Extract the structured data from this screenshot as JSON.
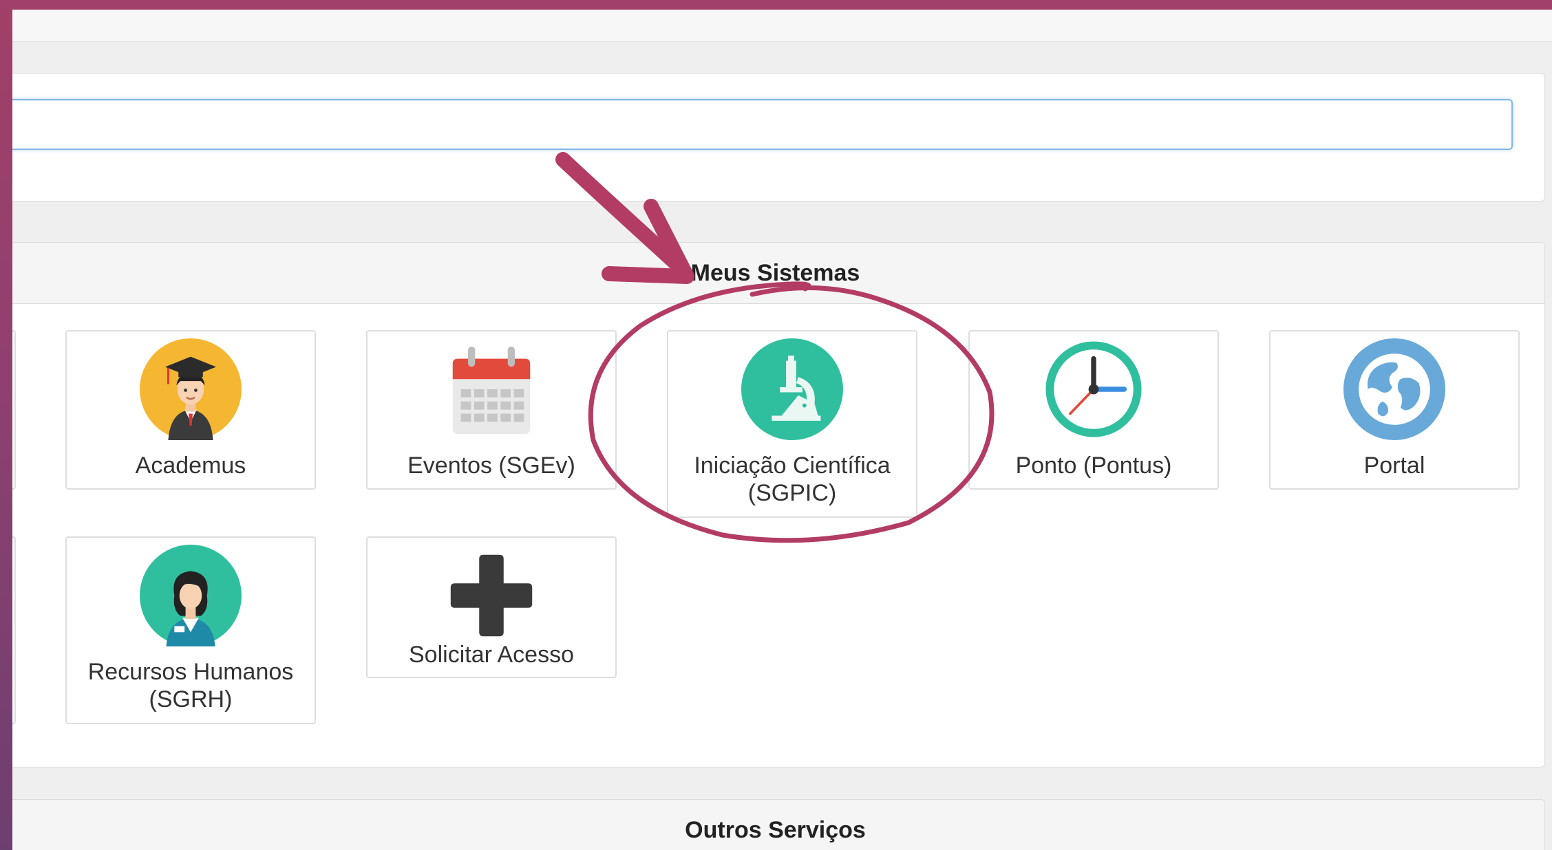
{
  "search": {
    "value": ""
  },
  "sections": {
    "my_systems_title": "Meus Sistemas",
    "other_services_title": "Outros Serviços"
  },
  "tiles": [
    {
      "label": "Academus",
      "icon": "graduate-icon"
    },
    {
      "label": "Eventos (SGEv)",
      "icon": "calendar-icon"
    },
    {
      "label": "Iniciação Científica (SGPIC)",
      "icon": "microscope-icon"
    },
    {
      "label": "Ponto (Pontus)",
      "icon": "clock-icon"
    },
    {
      "label": "Portal",
      "icon": "globe-icon"
    },
    {
      "label": "Recursos Humanos (SGRH)",
      "icon": "employee-icon"
    },
    {
      "label": "Solicitar Acesso",
      "icon": "plus-icon"
    }
  ],
  "colors": {
    "annotation": "#b33c64",
    "academus_bg": "#f5b731",
    "teal": "#2fbf9f",
    "globe": "#68a9d9",
    "calendar_red": "#e24a3b"
  }
}
